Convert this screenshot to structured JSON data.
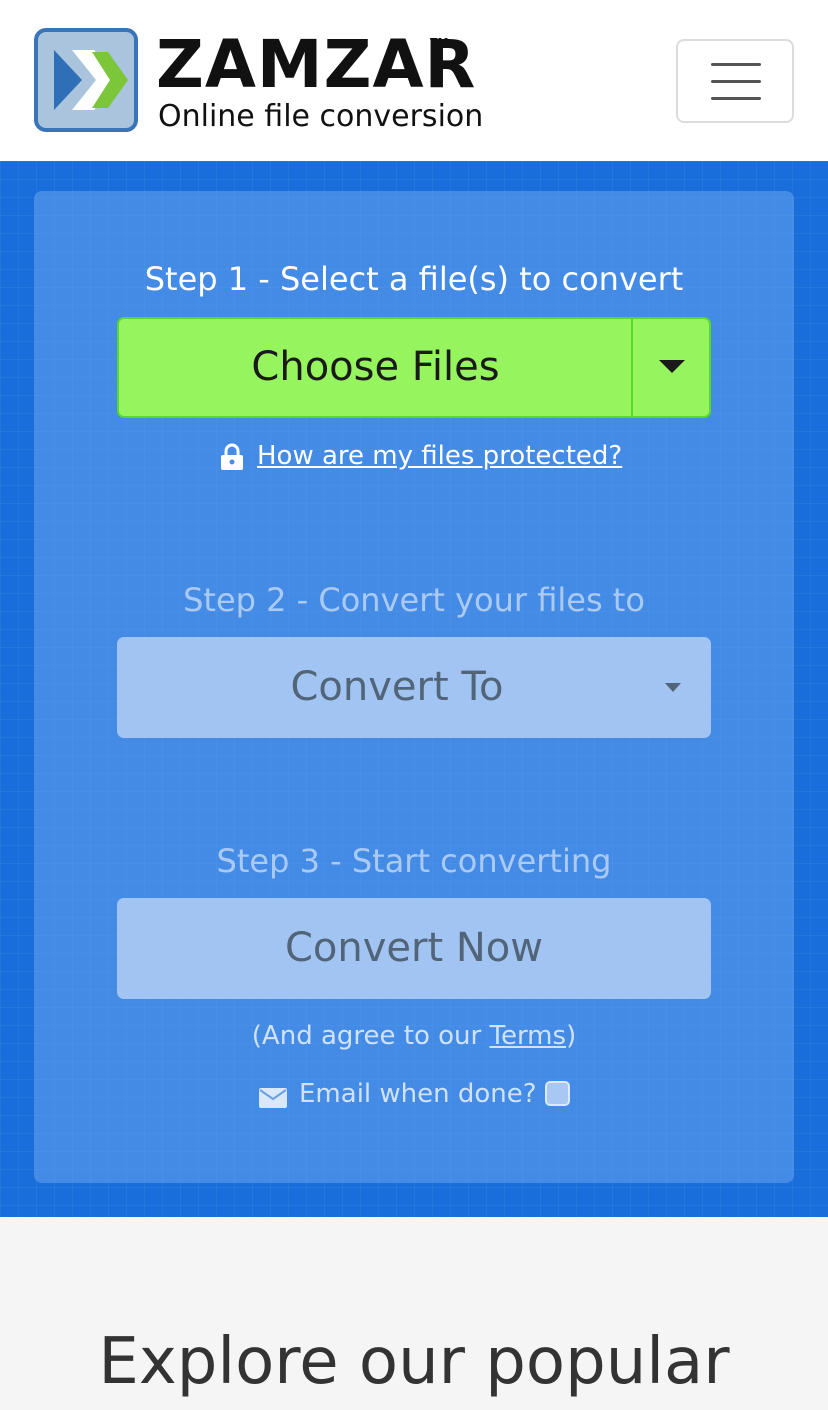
{
  "header": {
    "brand": "ZAMZAR",
    "trademark": "TM",
    "tagline": "Online file conversion",
    "menu_icon": "hamburger-menu-icon"
  },
  "converter": {
    "step1_label": "Step 1 - Select a file(s) to convert",
    "choose_files_label": "Choose Files",
    "protect_link": "How are my files protected?",
    "step2_label": "Step 2 - Convert your files to",
    "convert_to_label": "Convert To",
    "step3_label": "Step 3 - Start converting",
    "convert_now_label": "Convert Now",
    "agree_prefix": "(And agree to our ",
    "terms_link": "Terms",
    "agree_suffix": ")",
    "email_label": "Email when done?"
  },
  "explore": {
    "heading": "Explore our popular"
  },
  "colors": {
    "hero_bg": "#1a6edb",
    "choose_button": "#96f55e",
    "disabled_button": "#a2c4f3"
  }
}
